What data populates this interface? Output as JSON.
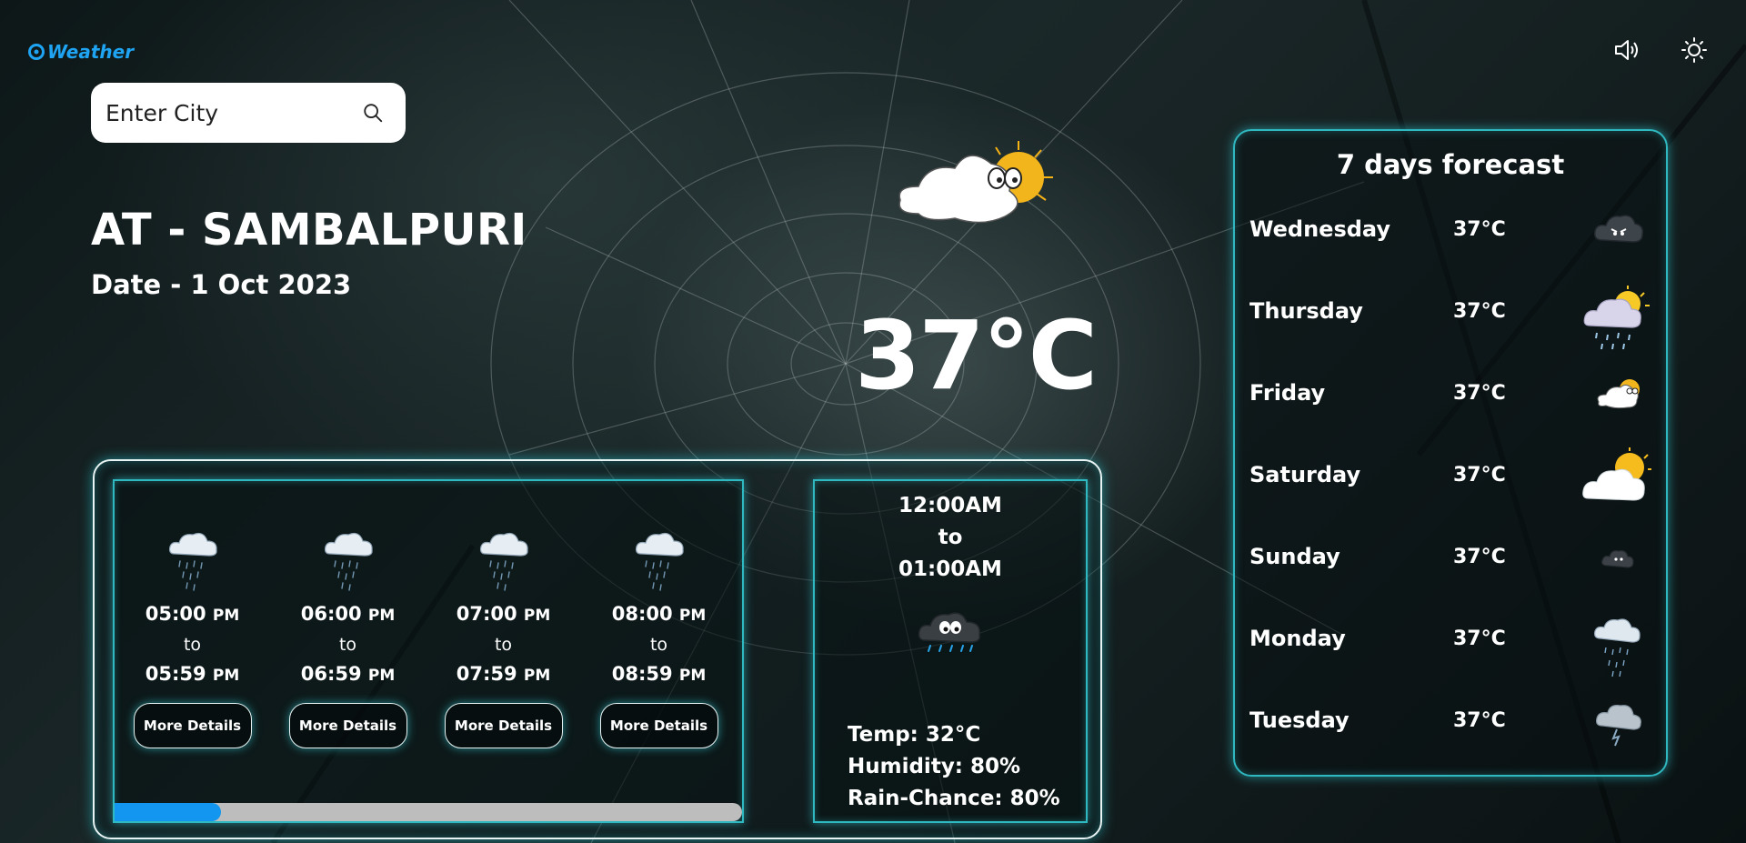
{
  "app": {
    "logo_text": "Weather"
  },
  "header": {
    "sound_icon": "speaker-icon",
    "theme_icon": "sun-icon"
  },
  "search": {
    "placeholder": "Enter City",
    "icon": "search-icon"
  },
  "location": {
    "city_line": "AT - SAMBALPURI",
    "date_line": "Date - 1 Oct 2023"
  },
  "current": {
    "temperature": "37°C",
    "icon": "sun-behind-cloud-icon"
  },
  "hourly": {
    "items": [
      {
        "from_time": "05:00",
        "from_period": "PM",
        "to": "to",
        "to_time": "05:59",
        "to_period": "PM",
        "button": "More Details",
        "icon": "rain-cloud-icon"
      },
      {
        "from_time": "06:00",
        "from_period": "PM",
        "to": "to",
        "to_time": "06:59",
        "to_period": "PM",
        "button": "More Details",
        "icon": "rain-cloud-icon"
      },
      {
        "from_time": "07:00",
        "from_period": "PM",
        "to": "to",
        "to_time": "07:59",
        "to_period": "PM",
        "button": "More Details",
        "icon": "rain-cloud-icon"
      },
      {
        "from_time": "08:00",
        "from_period": "PM",
        "to": "to",
        "to_time": "08:59",
        "to_period": "PM",
        "button": "More Details",
        "icon": "rain-cloud-icon"
      }
    ],
    "scroll_progress": 0.17,
    "scroll_color": "#1296ef"
  },
  "detail": {
    "from": "12:00AM",
    "to": "to",
    "until": "01:00AM",
    "icon": "rain-cloud-icon",
    "temp": "Temp: 32°C",
    "humidity": "Humidity: 80%",
    "rain": "Rain-Chance: 80%"
  },
  "forecast": {
    "title": "7 days forecast",
    "days": [
      {
        "day": "Wednesday",
        "temp": "37°C",
        "icon": "storm-cloud-icon"
      },
      {
        "day": "Thursday",
        "temp": "37°C",
        "icon": "sun-rain-cloud-icon"
      },
      {
        "day": "Friday",
        "temp": "37°C",
        "icon": "sun-behind-cloud-icon"
      },
      {
        "day": "Saturday",
        "temp": "37°C",
        "icon": "partly-sunny-icon"
      },
      {
        "day": "Sunday",
        "temp": "37°C",
        "icon": "dark-cloud-icon"
      },
      {
        "day": "Monday",
        "temp": "37°C",
        "icon": "rain-cloud-icon"
      },
      {
        "day": "Tuesday",
        "temp": "37°C",
        "icon": "thunder-cloud-icon"
      }
    ]
  },
  "colors": {
    "accent": "#1ea4f2",
    "glow": "#2fb8c0",
    "scroll_track": "#bdbdbd"
  }
}
